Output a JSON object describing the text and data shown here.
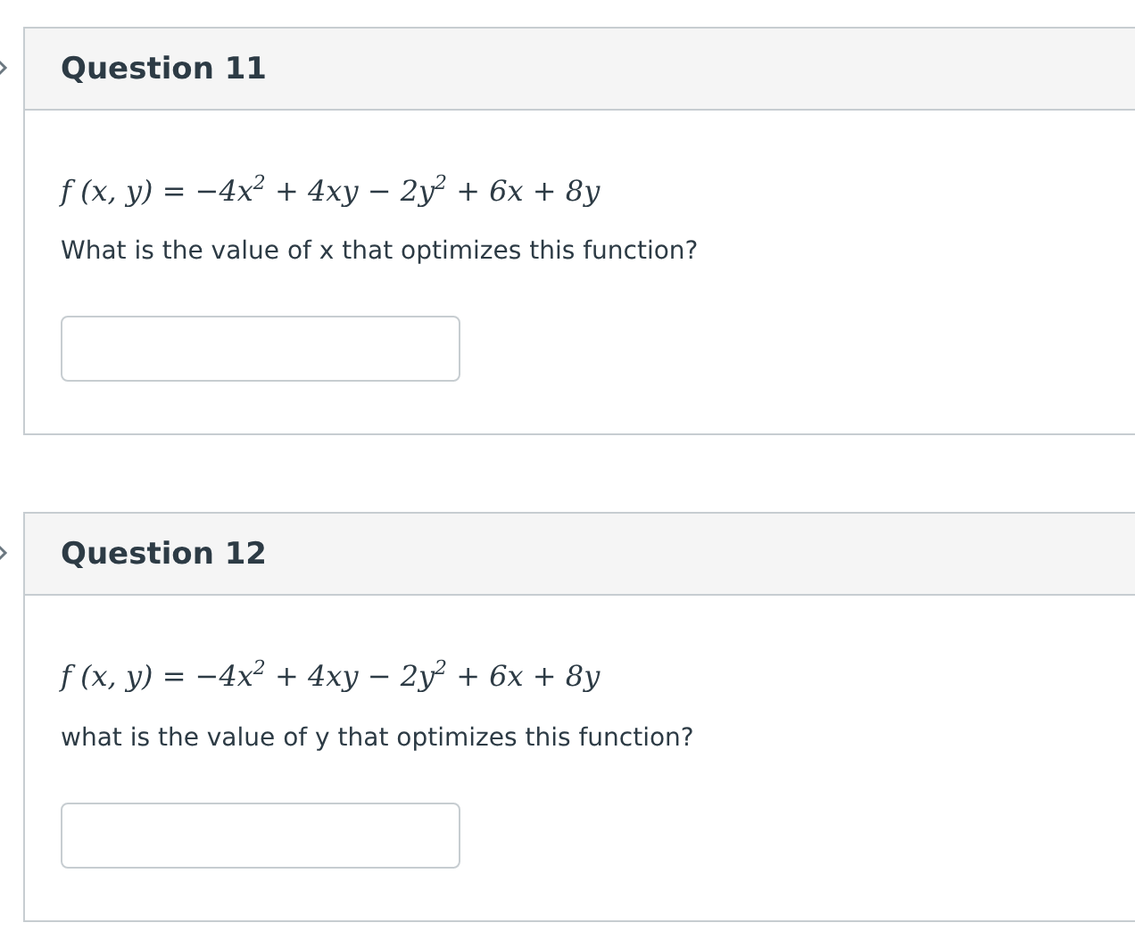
{
  "questions": [
    {
      "title": "Question 11",
      "formula": "f (x, y) = −4x$^{2}$ + 4xy − 2y$^{2}$ + 6x + 8y",
      "prompt": "What is the value of x that optimizes this function?"
    },
    {
      "title": "Question 12",
      "formula": "f (x, y) = −4x$^{2}$ + 4xy − 2y$^{2}$ + 6x + 8y",
      "prompt": "what is the value of y that optimizes this function?"
    }
  ]
}
